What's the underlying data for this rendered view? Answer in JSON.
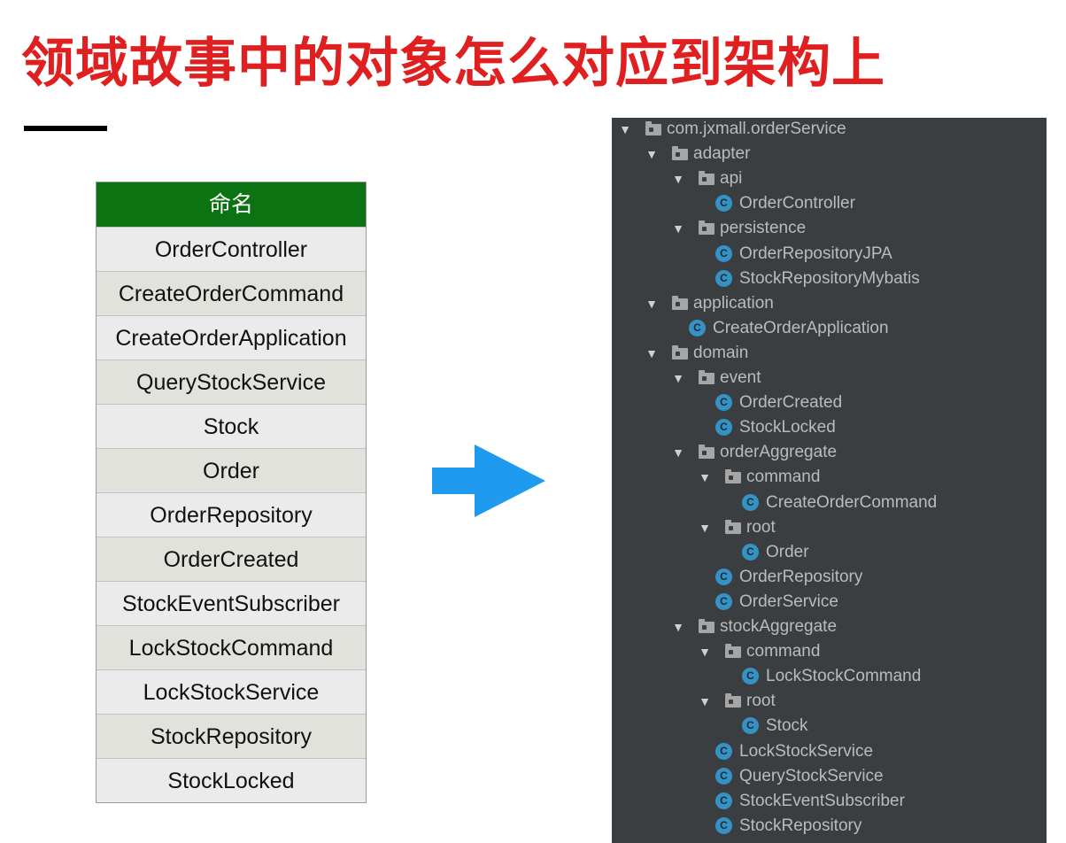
{
  "title": "领域故事中的对象怎么对应到架构上",
  "colors": {
    "title": "#e02020",
    "table_header": "#0c7312",
    "arrow": "#1e9bef",
    "tree_bg": "#3b3e40",
    "tree_text": "#bbbbbb",
    "class_icon": "#3592c4"
  },
  "table": {
    "header": "命名",
    "rows": [
      "OrderController",
      "CreateOrderCommand",
      "CreateOrderApplication",
      "QueryStockService",
      "Stock",
      "Order",
      "OrderRepository",
      "OrderCreated",
      "StockEventSubscriber",
      "LockStockCommand",
      "LockStockService",
      "StockRepository",
      "StockLocked"
    ]
  },
  "arrow_icon": "right-arrow-icon",
  "tree": {
    "icons": {
      "expanded": "triangle-down-icon",
      "package": "folder-icon",
      "class": "class-c-icon"
    },
    "class_badge": "C",
    "expand_glyph": "▼",
    "items": [
      {
        "label": "com.jxmall.orderService",
        "kind": "package",
        "depth": 0
      },
      {
        "label": "adapter",
        "kind": "package",
        "depth": 1
      },
      {
        "label": "api",
        "kind": "package",
        "depth": 2
      },
      {
        "label": "OrderController",
        "kind": "class",
        "depth": 3
      },
      {
        "label": "persistence",
        "kind": "package",
        "depth": 2
      },
      {
        "label": "OrderRepositoryJPA",
        "kind": "class",
        "depth": 3
      },
      {
        "label": "StockRepositoryMybatis",
        "kind": "class",
        "depth": 3
      },
      {
        "label": "application",
        "kind": "package",
        "depth": 1
      },
      {
        "label": "CreateOrderApplication",
        "kind": "class",
        "depth": 2
      },
      {
        "label": "domain",
        "kind": "package",
        "depth": 1
      },
      {
        "label": "event",
        "kind": "package",
        "depth": 2
      },
      {
        "label": "OrderCreated",
        "kind": "class",
        "depth": 3
      },
      {
        "label": "StockLocked",
        "kind": "class",
        "depth": 3
      },
      {
        "label": "orderAggregate",
        "kind": "package",
        "depth": 2
      },
      {
        "label": "command",
        "kind": "package",
        "depth": 3
      },
      {
        "label": "CreateOrderCommand",
        "kind": "class",
        "depth": 4
      },
      {
        "label": "root",
        "kind": "package",
        "depth": 3
      },
      {
        "label": "Order",
        "kind": "class",
        "depth": 4
      },
      {
        "label": "OrderRepository",
        "kind": "class",
        "depth": 3
      },
      {
        "label": "OrderService",
        "kind": "class",
        "depth": 3
      },
      {
        "label": "stockAggregate",
        "kind": "package",
        "depth": 2
      },
      {
        "label": "command",
        "kind": "package",
        "depth": 3
      },
      {
        "label": "LockStockCommand",
        "kind": "class",
        "depth": 4
      },
      {
        "label": "root",
        "kind": "package",
        "depth": 3
      },
      {
        "label": "Stock",
        "kind": "class",
        "depth": 4
      },
      {
        "label": "LockStockService",
        "kind": "class",
        "depth": 3
      },
      {
        "label": "QueryStockService",
        "kind": "class",
        "depth": 3
      },
      {
        "label": "StockEventSubscriber",
        "kind": "class",
        "depth": 3
      },
      {
        "label": "StockRepository",
        "kind": "class",
        "depth": 3
      }
    ]
  }
}
